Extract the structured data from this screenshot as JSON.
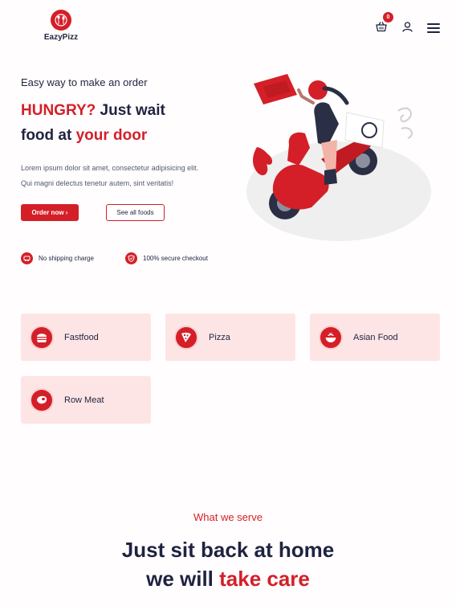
{
  "brand": {
    "name": "EazyPizz",
    "accent": "#d41f28",
    "dark": "#1f2340"
  },
  "header": {
    "cart_icon": "basket-icon",
    "cart_count": "0",
    "user_icon": "user-icon",
    "menu_icon": "hamburger-icon"
  },
  "hero": {
    "kicker": "Easy way to make an order",
    "title_part1": "HUNGRY?",
    "title_part2": " Just wait",
    "title_part3": "food at ",
    "title_part4": "your door",
    "desc_line1": "Lorem ipsum dolor sit amet, consectetur adipisicing elit.",
    "desc_line2": "Qui magni delectus tenetur autem, sint veritatis!",
    "primary_button": "Order now ›",
    "secondary_button": "See all foods",
    "illustration": "delivery-scooter-illustration"
  },
  "features": [
    {
      "label": "No shipping charge",
      "icon": "truck-icon"
    },
    {
      "label": "100% secure checkout",
      "icon": "shield-icon"
    }
  ],
  "categories": [
    {
      "label": "Fastfood",
      "icon": "burger-icon"
    },
    {
      "label": "Pizza",
      "icon": "pizza-icon"
    },
    {
      "label": "Asian Food",
      "icon": "bowl-icon"
    },
    {
      "label": "Row Meat",
      "icon": "meat-icon"
    }
  ],
  "serve": {
    "kicker": "What we serve",
    "title_line1": "Just sit back at home",
    "title_line2_a": "we will ",
    "title_line2_b": "take care"
  }
}
